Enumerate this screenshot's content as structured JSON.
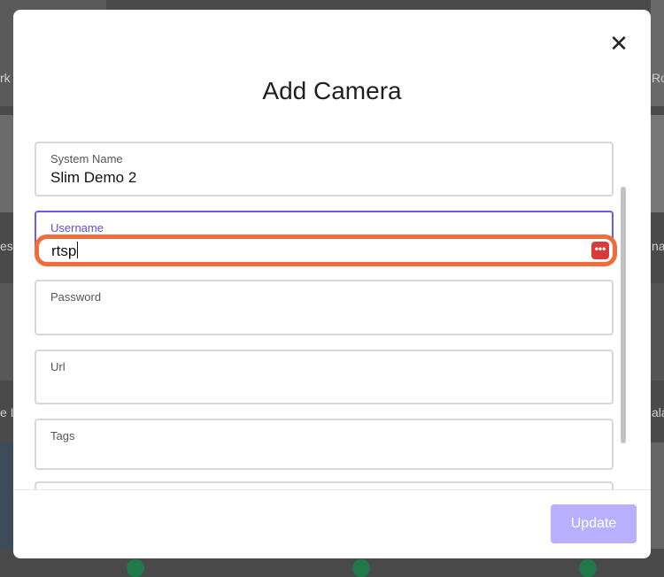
{
  "modal": {
    "title": "Add Camera",
    "close_icon": "close-icon"
  },
  "fields": {
    "system_name": {
      "label": "System Name",
      "value": "Slim Demo 2"
    },
    "username": {
      "label": "Username",
      "value": "rtsp"
    },
    "password": {
      "label": "Password",
      "value": ""
    },
    "url": {
      "label": "Url",
      "value": ""
    },
    "tags": {
      "label": "Tags",
      "value": ""
    }
  },
  "password_manager_icon": "password-manager-icon",
  "footer": {
    "update_label": "Update"
  },
  "background": {
    "partial_labels": [
      "rk",
      "Ro",
      "est",
      "nar",
      "e I",
      "ala"
    ]
  },
  "colors": {
    "accent": "#6a5ce8",
    "highlight": "#f26b3c",
    "update_button": "#b9afff",
    "password_icon": "#d93a3a"
  }
}
